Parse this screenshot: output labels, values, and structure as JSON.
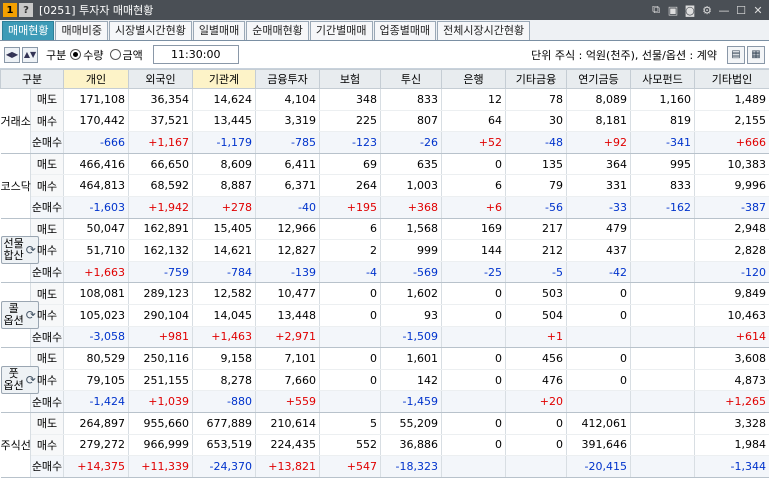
{
  "window": {
    "code": "[0251]",
    "title": "투자자 매매현황",
    "badge1": "1",
    "badge2": "?"
  },
  "tabs": [
    "매매현황",
    "매매비중",
    "시장별시간현황",
    "일별매매",
    "순매매현황",
    "기간별매매",
    "업종별매매",
    "전체시장시간현황"
  ],
  "toolbar": {
    "gubun": "구분",
    "radio1": "수량",
    "radio2": "금액",
    "time": "11:30:00",
    "unit": "단위 주식 : 억원(천주), 선물/옵션 : 계약"
  },
  "columns": [
    "구분",
    "개인",
    "외국인",
    "기관계",
    "금융투자",
    "보험",
    "투신",
    "은행",
    "기타금융",
    "연기금등",
    "사모펀드",
    "기타법인"
  ],
  "groups": [
    {
      "name": "거래소",
      "button": false,
      "rows": [
        {
          "label": "매도",
          "values": [
            "171,108",
            "36,354",
            "14,624",
            "4,104",
            "348",
            "833",
            "12",
            "78",
            "8,089",
            "1,160",
            "1,489"
          ]
        },
        {
          "label": "매수",
          "values": [
            "170,442",
            "37,521",
            "13,445",
            "3,319",
            "225",
            "807",
            "64",
            "30",
            "8,181",
            "819",
            "2,155"
          ]
        },
        {
          "label": "순매수",
          "values": [
            "-666",
            "+1,167",
            "-1,179",
            "-785",
            "-123",
            "-26",
            "+52",
            "-48",
            "+92",
            "-341",
            "+666"
          ]
        }
      ]
    },
    {
      "name": "코스닥",
      "button": false,
      "rows": [
        {
          "label": "매도",
          "values": [
            "466,416",
            "66,650",
            "8,609",
            "6,411",
            "69",
            "635",
            "0",
            "135",
            "364",
            "995",
            "10,383"
          ]
        },
        {
          "label": "매수",
          "values": [
            "464,813",
            "68,592",
            "8,887",
            "6,371",
            "264",
            "1,003",
            "6",
            "79",
            "331",
            "833",
            "9,996"
          ]
        },
        {
          "label": "순매수",
          "values": [
            "-1,603",
            "+1,942",
            "+278",
            "-40",
            "+195",
            "+368",
            "+6",
            "-56",
            "-33",
            "-162",
            "-387"
          ]
        }
      ]
    },
    {
      "name": "선물\n합산",
      "button": true,
      "rows": [
        {
          "label": "매도",
          "values": [
            "50,047",
            "162,891",
            "15,405",
            "12,966",
            "6",
            "1,568",
            "169",
            "217",
            "479",
            "",
            "2,948"
          ]
        },
        {
          "label": "매수",
          "values": [
            "51,710",
            "162,132",
            "14,621",
            "12,827",
            "2",
            "999",
            "144",
            "212",
            "437",
            "",
            "2,828"
          ]
        },
        {
          "label": "순매수",
          "values": [
            "+1,663",
            "-759",
            "-784",
            "-139",
            "-4",
            "-569",
            "-25",
            "-5",
            "-42",
            "",
            "-120"
          ]
        }
      ]
    },
    {
      "name": "콜\n옵션",
      "button": true,
      "rows": [
        {
          "label": "매도",
          "values": [
            "108,081",
            "289,123",
            "12,582",
            "10,477",
            "0",
            "1,602",
            "0",
            "503",
            "0",
            "",
            "9,849"
          ]
        },
        {
          "label": "매수",
          "values": [
            "105,023",
            "290,104",
            "14,045",
            "13,448",
            "0",
            "93",
            "0",
            "504",
            "0",
            "",
            "10,463"
          ]
        },
        {
          "label": "순매수",
          "values": [
            "-3,058",
            "+981",
            "+1,463",
            "+2,971",
            "",
            "-1,509",
            "",
            "+1",
            "",
            "",
            "+614"
          ]
        }
      ]
    },
    {
      "name": "풋\n옵션",
      "button": true,
      "rows": [
        {
          "label": "매도",
          "values": [
            "80,529",
            "250,116",
            "9,158",
            "7,101",
            "0",
            "1,601",
            "0",
            "456",
            "0",
            "",
            "3,608"
          ]
        },
        {
          "label": "매수",
          "values": [
            "79,105",
            "251,155",
            "8,278",
            "7,660",
            "0",
            "142",
            "0",
            "476",
            "0",
            "",
            "4,873"
          ]
        },
        {
          "label": "순매수",
          "values": [
            "-1,424",
            "+1,039",
            "-880",
            "+559",
            "",
            "-1,459",
            "",
            "+20",
            "",
            "",
            "+1,265"
          ]
        }
      ]
    },
    {
      "name": "주식선",
      "button": false,
      "rows": [
        {
          "label": "매도",
          "values": [
            "264,897",
            "955,660",
            "677,889",
            "210,614",
            "5",
            "55,209",
            "0",
            "0",
            "412,061",
            "",
            "3,328"
          ]
        },
        {
          "label": "매수",
          "values": [
            "279,272",
            "966,999",
            "653,519",
            "224,435",
            "552",
            "36,886",
            "0",
            "0",
            "391,646",
            "",
            "1,984"
          ]
        },
        {
          "label": "순매수",
          "values": [
            "+14,375",
            "+11,339",
            "-24,370",
            "+13,821",
            "+547",
            "-18,323",
            "",
            "",
            "-20,415",
            "",
            "-1,344"
          ]
        }
      ]
    }
  ]
}
